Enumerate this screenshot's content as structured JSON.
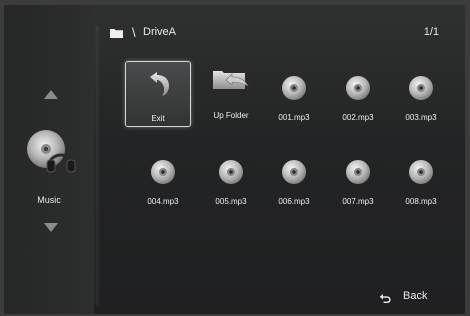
{
  "sidebar": {
    "category_label": "Music",
    "up_icon": "chevron-up-icon",
    "down_icon": "chevron-down-icon",
    "category_icon": "music-disc-headphones-icon"
  },
  "header": {
    "path_separator": "\\",
    "path_name": "DriveA",
    "page_indicator": "1/1",
    "folder_icon": "folder-icon"
  },
  "items": [
    {
      "label": "Exit",
      "icon": "exit-arrow-icon",
      "selected": true
    },
    {
      "label": "Up Folder",
      "icon": "up-folder-icon",
      "selected": false
    },
    {
      "label": "001.mp3",
      "icon": "disc-icon",
      "selected": false
    },
    {
      "label": "002.mp3",
      "icon": "disc-icon",
      "selected": false
    },
    {
      "label": "003.mp3",
      "icon": "disc-icon",
      "selected": false
    },
    {
      "label": "004.mp3",
      "icon": "disc-icon",
      "selected": false
    },
    {
      "label": "005.mp3",
      "icon": "disc-icon",
      "selected": false
    },
    {
      "label": "006.mp3",
      "icon": "disc-icon",
      "selected": false
    },
    {
      "label": "007.mp3",
      "icon": "disc-icon",
      "selected": false
    },
    {
      "label": "008.mp3",
      "icon": "disc-icon",
      "selected": false
    }
  ],
  "footer": {
    "back_label": "Back",
    "back_icon": "return-arrow-icon"
  }
}
